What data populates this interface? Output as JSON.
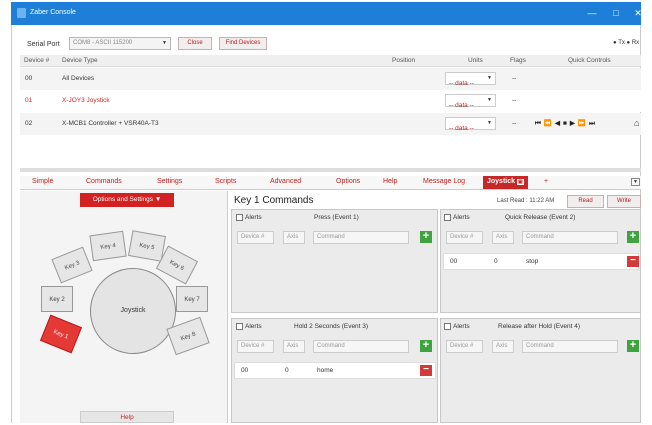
{
  "window": {
    "title": "Zaber Console"
  },
  "toolbar": {
    "serial_label": "Serial Port",
    "serial_value": "COM8 - ASCII 115200",
    "close_label": "Close",
    "find_label": "Find Devices",
    "tx_label": "Tx",
    "rx_label": "Rx"
  },
  "grid": {
    "columns": [
      "Device #",
      "Device Type",
      "Position",
      "Units",
      "Flags",
      "Quick Controls"
    ],
    "rows": [
      {
        "num": "00",
        "type": "All Devices",
        "units": "-- data --",
        "flags": "--"
      },
      {
        "num": "01",
        "type": "X-JOY3 Joystick",
        "units": "-- data --",
        "flags": "--"
      },
      {
        "num": "02",
        "type": "X-MCB1 Controller + VSR40A-T3",
        "units": "-- data --",
        "flags": "--"
      }
    ]
  },
  "tabs": [
    "Simple",
    "Commands",
    "Settings",
    "Scripts",
    "Advanced",
    "Options",
    "Help",
    "Message Log",
    "Joystick"
  ],
  "left": {
    "options_label": "Options and Settings",
    "joystick_label": "Joystick",
    "keys": [
      "Key 1",
      "Key 2",
      "Key 3",
      "Key 4",
      "Key 5",
      "Key 6",
      "Key 7",
      "Key 8"
    ],
    "help_label": "Help"
  },
  "key_commands": {
    "title": "Key 1 Commands",
    "last_read": "Last Read : 11:22 AM",
    "read_label": "Read",
    "write_label": "Write",
    "alerts_label": "Alerts",
    "placeholders": {
      "device": "Device #",
      "axis": "Axis",
      "command": "Command"
    },
    "events": [
      {
        "title": "Press (Event 1)",
        "rows": []
      },
      {
        "title": "Quick Release (Event 2)",
        "rows": [
          {
            "device": "00",
            "axis": "0",
            "command": "stop"
          }
        ]
      },
      {
        "title": "Hold 2 Seconds (Event 3)",
        "rows": [
          {
            "device": "00",
            "axis": "0",
            "command": "home"
          }
        ]
      },
      {
        "title": "Release after Hold (Event 4)",
        "rows": []
      }
    ]
  },
  "colors": {
    "accent": "#c62828",
    "titlebar": "#1e7fd8",
    "add": "#3fa33f",
    "remove": "#d33a3a"
  }
}
